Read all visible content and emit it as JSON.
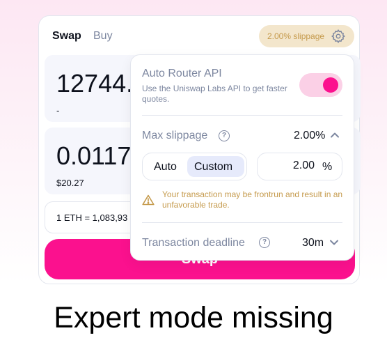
{
  "tabs": {
    "swap": "Swap",
    "buy": "Buy"
  },
  "slippage_button": {
    "label": "2.00% slippage"
  },
  "input_panel": {
    "amount": "12744.",
    "usd": "-"
  },
  "output_panel": {
    "amount": "0.0117",
    "usd": "$20.27"
  },
  "rate": {
    "text": "1 ETH = 1,083,93"
  },
  "swap_button": {
    "label": "Swap"
  },
  "settings": {
    "auto_router": {
      "title": "Auto Router API",
      "description": "Use the Uniswap Labs API to get faster quotes.",
      "enabled": true
    },
    "max_slippage": {
      "label": "Max slippage",
      "value": "2.00%",
      "auto_label": "Auto",
      "custom_label": "Custom",
      "input_value": "2.00",
      "unit": "%"
    },
    "warning": "Your transaction may be frontrun and result in an unfavorable trade.",
    "deadline": {
      "label": "Transaction deadline",
      "value": "30m"
    }
  },
  "caption": "Expert mode missing",
  "colors": {
    "accent": "#fb118e",
    "warning": "#c59a4c",
    "muted": "#7d87a0"
  }
}
